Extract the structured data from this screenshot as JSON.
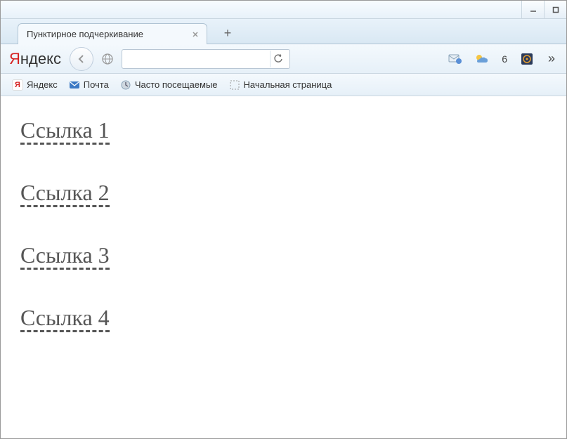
{
  "window": {
    "controls": {
      "minimize": "minimize",
      "maximize": "maximize"
    }
  },
  "tab": {
    "title": "Пунктирное подчеркивание"
  },
  "toolbar": {
    "brand_prefix": "Я",
    "brand_rest": "ндекс",
    "url": "",
    "badge_number": "6"
  },
  "bookmarks": {
    "items": [
      {
        "label": "Яндекс",
        "icon": "yandex"
      },
      {
        "label": "Почта",
        "icon": "mail"
      },
      {
        "label": "Часто посещаемые",
        "icon": "mostvisited"
      },
      {
        "label": "Начальная страница",
        "icon": "placeholder"
      }
    ]
  },
  "page": {
    "links": [
      "Ссылка 1",
      "Ссылка 2",
      "Ссылка 3",
      "Ссылка 4"
    ]
  }
}
